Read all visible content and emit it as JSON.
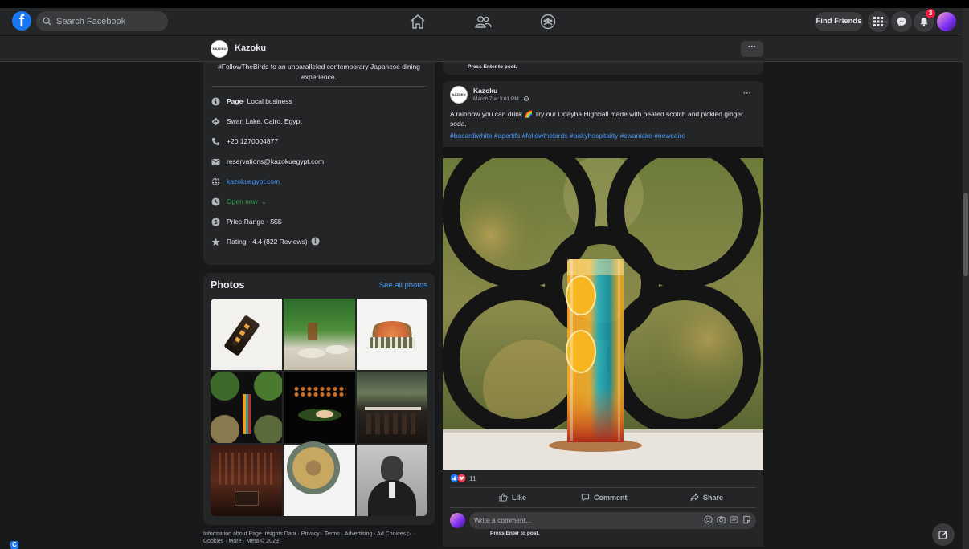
{
  "nav": {
    "search_placeholder": "Search Facebook",
    "find_friends": "Find Friends",
    "notification_count": "3",
    "logo_letter": "f"
  },
  "page": {
    "name": "Kazoku",
    "logo_text": "KAZOKU",
    "more_label": "···"
  },
  "intro": {
    "description": "#FollowTheBirds to an unparalleled contemporary Japanese dining experience.",
    "items": [
      {
        "icon": "info-icon",
        "bold": "Page",
        "text": " · Local business"
      },
      {
        "icon": "location-icon",
        "text": "Swan Lake, Cairo, Egypt"
      },
      {
        "icon": "phone-icon",
        "text": "+20 1270004877"
      },
      {
        "icon": "email-icon",
        "text": "reservations@kazokuegypt.com"
      },
      {
        "icon": "globe-icon",
        "text": "kazokuegypt.com"
      },
      {
        "icon": "clock-icon",
        "text": "Open now",
        "suffix": "⌄"
      },
      {
        "icon": "price-icon",
        "text": "Price Range · $$$"
      },
      {
        "icon": "star-icon",
        "text": "Rating · 4.4 (822 Reviews)"
      }
    ]
  },
  "photos": {
    "title": "Photos",
    "see_all": "See all photos"
  },
  "footer": {
    "text": "Information about Page Insights Data · Privacy · Terms · Advertising · Ad Choices ▷ · Cookies · More · Meta © 2023"
  },
  "prev_post": {
    "hint": "Press Enter to post."
  },
  "post": {
    "author": "Kazoku",
    "date": "March 7 at 3:01 PM · ",
    "text": "A rainbow you can drink 🌈  Try our Odayba Highball  made with peated scotch and pickled ginger soda.",
    "tags": "#bacardiwhite #apertifs #followthebirds #bakyhospitality #swanlake #newcairo",
    "reaction_count": "11",
    "like": "Like",
    "comment": "Comment",
    "share": "Share",
    "comment_placeholder": "Write a comment...",
    "comment_hint": "Press Enter to post.",
    "dots": "···"
  },
  "colors": {
    "background": "#18191a",
    "card": "#242526",
    "accent": "#1877f2",
    "link": "#4599ff",
    "open_green": "#31a24c",
    "badge_red": "#e41e3f"
  }
}
